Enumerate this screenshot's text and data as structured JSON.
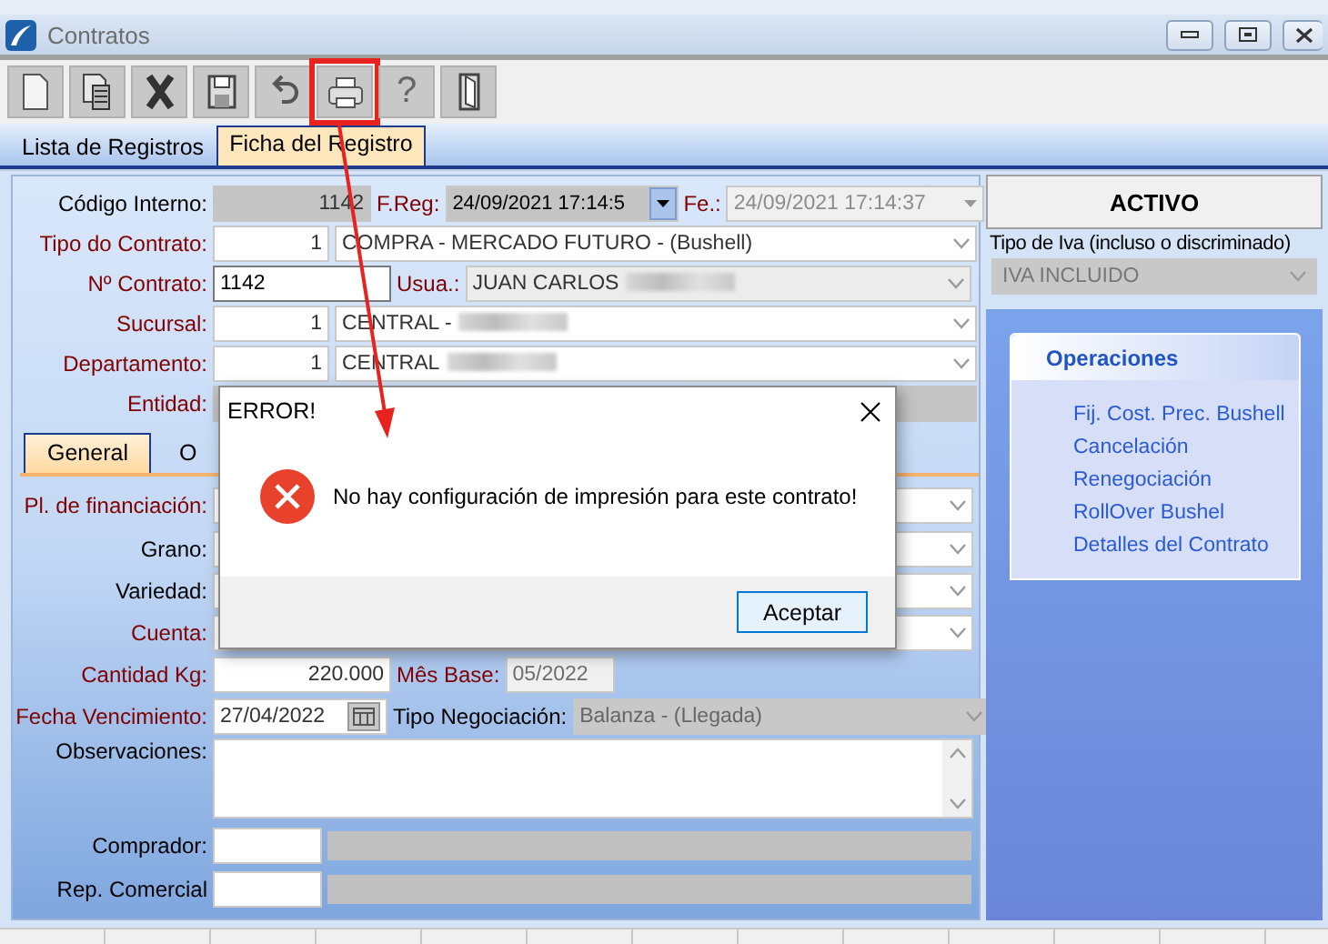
{
  "window": {
    "title": "Contratos"
  },
  "toolbar": {
    "buttons": [
      {
        "kind": "new",
        "highlighted": false
      },
      {
        "kind": "copy",
        "highlighted": false
      },
      {
        "kind": "delete",
        "highlighted": false
      },
      {
        "kind": "save",
        "highlighted": false
      },
      {
        "kind": "undo",
        "highlighted": false
      },
      {
        "kind": "print",
        "highlighted": true
      },
      {
        "kind": "help",
        "glyph": "?",
        "highlighted": false
      },
      {
        "kind": "exit",
        "highlighted": false
      }
    ]
  },
  "tabs": [
    {
      "label": "Lista de Registros",
      "selected": false
    },
    {
      "label": "Ficha del Registro",
      "selected": true
    }
  ],
  "form": {
    "codigo_interno": {
      "label": "Código Interno:",
      "required": false,
      "value": "1142"
    },
    "f_reg": {
      "label": "F.Reg:",
      "required": true,
      "value": "24/09/2021 17:14:5"
    },
    "fe": {
      "label": "Fe.:",
      "required": true,
      "value": "24/09/2021 17:14:37",
      "disabled": true
    },
    "tipo_contrato": {
      "label": "Tipo do Contrato:",
      "required": true,
      "code": "1",
      "value": "COMPRA - MERCADO FUTURO - (Bushell)"
    },
    "nro_contrato": {
      "label": "Nº Contrato:",
      "required": true,
      "value": "1142"
    },
    "usuario": {
      "label": "Usua.:",
      "required": true,
      "value": "JUAN CARLOS",
      "redacted": true
    },
    "sucursal": {
      "label": "Sucursal:",
      "required": true,
      "code": "1",
      "value": "CENTRAL -",
      "redacted": true
    },
    "departamento": {
      "label": "Departamento:",
      "required": true,
      "code": "1",
      "value": "CENTRAL",
      "redacted": true
    },
    "entidad": {
      "label": "Entidad:",
      "required": true
    },
    "sub_tabs": [
      {
        "label": "General",
        "selected": true
      },
      {
        "label": "O",
        "selected": false
      }
    ],
    "financiacion": {
      "label": "Pl. de financiación:",
      "required": true
    },
    "grano": {
      "label": "Grano:",
      "required": false
    },
    "variedad": {
      "label": "Variedad:",
      "required": false
    },
    "cuenta": {
      "label": "Cuenta:",
      "required": true
    },
    "cantidad": {
      "label": "Cantidad Kg:",
      "required": true,
      "value": "220.000"
    },
    "mes_base": {
      "label": "Mês Base:",
      "required": true,
      "value": "05/2022",
      "disabled": true
    },
    "vencimiento": {
      "label": "Fecha Vencimiento:",
      "required": true,
      "value": "27/04/2022"
    },
    "tipo_negociacion": {
      "label": "Tipo Negociación:",
      "required": false,
      "value": "Balanza - (Llegada)",
      "disabled": true
    },
    "observaciones": {
      "label": "Observaciones:",
      "required": false
    },
    "comprador": {
      "label": "Comprador:",
      "required": false
    },
    "rep_comercial": {
      "label": "Rep. Comercial",
      "required": false
    }
  },
  "side": {
    "status": "ACTIVO",
    "iva": {
      "label": "Tipo de Iva (incluso o discriminado)",
      "value": "IVA INCLUIDO",
      "disabled": true
    },
    "operations": {
      "title": "Operaciones",
      "items": [
        "Fij. Cost. Prec. Bushell",
        "Cancelación",
        "Renegociación",
        "RollOver Bushel",
        "Detalles del Contrato"
      ]
    }
  },
  "dialog": {
    "title": "ERROR!",
    "message": "No hay configuración de impresión para este contrato!",
    "button": "Aceptar"
  }
}
